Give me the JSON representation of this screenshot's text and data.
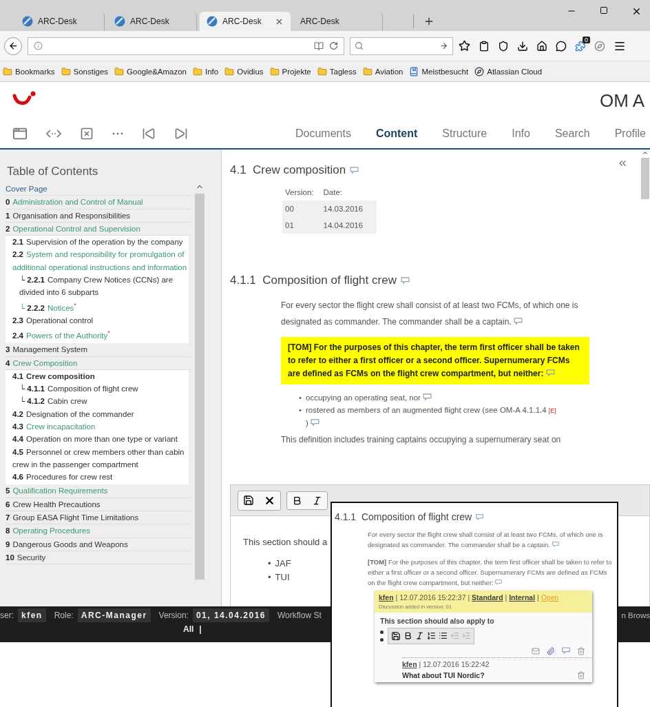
{
  "browser": {
    "tabs": [
      {
        "label": "ARC-Desk",
        "favicon": true,
        "selected": false
      },
      {
        "label": "ARC-Desk",
        "favicon": true,
        "selected": false
      },
      {
        "label": "ARC-Desk",
        "favicon": true,
        "selected": true
      },
      {
        "label": "ARC-Desk",
        "favicon": false,
        "selected": false
      }
    ],
    "extension_badge": "0",
    "bookmarks": [
      {
        "label": "Bookmarks",
        "kind": "folder"
      },
      {
        "label": "Sonstiges",
        "kind": "folder"
      },
      {
        "label": "Google&Amazon",
        "kind": "folder"
      },
      {
        "label": "Info",
        "kind": "folder"
      },
      {
        "label": "Ovidius",
        "kind": "folder"
      },
      {
        "label": "Projekte",
        "kind": "folder"
      },
      {
        "label": "Tagless",
        "kind": "folder"
      },
      {
        "label": "Aviation",
        "kind": "folder"
      },
      {
        "label": "Meistbesucht",
        "kind": "smart"
      },
      {
        "label": "Atlassian Cloud",
        "kind": "site"
      }
    ]
  },
  "app": {
    "title": "OM A",
    "nav": [
      {
        "label": "Documents",
        "selected": false
      },
      {
        "label": "Content",
        "selected": true
      },
      {
        "label": "Structure",
        "selected": false
      },
      {
        "label": "Info",
        "selected": false
      },
      {
        "label": "Search",
        "selected": false
      },
      {
        "label": "Profile",
        "selected": false
      }
    ]
  },
  "toc": {
    "title": "Table of Contents",
    "items": [
      {
        "label": "Cover Page",
        "color": "#2f5f8f",
        "selected": false
      },
      {
        "number": "0",
        "label": "Administration and Control of Manual",
        "color": "#3f9a6e",
        "selected": false
      },
      {
        "number": "1",
        "label": "Organisation and Responsibilities",
        "color": "#333333",
        "selected": false
      },
      {
        "number": "2",
        "label": "Operational Control and Supervision",
        "color": "#3f9a6e",
        "selected": false,
        "children": [
          {
            "number": "2.1",
            "label": "Supervision of the operation by the company",
            "color": "#333333",
            "selected": false
          },
          {
            "number": "2.2",
            "label": "System and responsibility for promulgation of additional operational instructions and information",
            "color": "#3f9a6e",
            "selected": false,
            "children": [
              {
                "branch": "└",
                "number": "2.2.1",
                "label": "Company Crew Notices (CCNs) are divided into 6 subparts",
                "color": "#333333",
                "selected": false
              },
              {
                "branch": "└",
                "number": "2.2.2",
                "label": "Notices",
                "marker": "*",
                "color": "#3f9a6e",
                "selected": false
              }
            ]
          },
          {
            "number": "2.3",
            "label": "Operational control",
            "color": "#333333",
            "selected": false
          },
          {
            "number": "2.4",
            "label": "Powers of the Authority",
            "marker": "*",
            "color": "#3f9a6e",
            "selected": false
          }
        ]
      },
      {
        "number": "3",
        "label": "Management System",
        "color": "#333333",
        "selected": false
      },
      {
        "number": "4",
        "label": "Crew Composition",
        "color": "#3f9a6e",
        "selected": false,
        "children": [
          {
            "number": "4.1",
            "label": "Crew composition",
            "color": "#333333",
            "selected": true,
            "children": [
              {
                "branch": "└",
                "number": "4.1.1",
                "label": "Composition of flight crew",
                "color": "#333333",
                "selected": false
              },
              {
                "branch": "└",
                "number": "4.1.2",
                "label": "Cabin crew",
                "color": "#333333",
                "selected": false
              }
            ]
          },
          {
            "number": "4.2",
            "label": "Designation of the commander",
            "color": "#333333",
            "selected": false
          },
          {
            "number": "4.3",
            "label": "Crew incapacitation",
            "color": "#3f9a6e",
            "selected": false
          },
          {
            "number": "4.4",
            "label": "Operation on more than one type or variant",
            "color": "#333333",
            "selected": false
          },
          {
            "number": "4.5",
            "label": "Personnel or crew members other than cabin crew in the passenger compartment",
            "color": "#333333",
            "selected": false
          },
          {
            "number": "4.6",
            "label": "Procedures for crew rest",
            "color": "#333333",
            "selected": false
          }
        ]
      },
      {
        "number": "5",
        "label": "Qualification Requirements",
        "color": "#3f9a6e",
        "selected": false
      },
      {
        "number": "6",
        "label": "Crew Health Precautions",
        "color": "#333333",
        "selected": false
      },
      {
        "number": "7",
        "label": "Group EASA Flight Time Limitations",
        "color": "#333333",
        "selected": false
      },
      {
        "number": "8",
        "label": "Operating Procedures",
        "color": "#3f9a6e",
        "selected": false
      },
      {
        "number": "9",
        "label": "Dangerous Goods and Weapons",
        "color": "#333333",
        "selected": false
      },
      {
        "number": "10",
        "label": "Security",
        "color": "#333333",
        "selected": false
      }
    ]
  },
  "content": {
    "section": {
      "number": "4.1",
      "title": "Crew composition"
    },
    "versions": {
      "columns": [
        "Version:",
        "Date:"
      ],
      "rows": [
        [
          "00",
          "14.03.2016"
        ],
        [
          "01",
          "14.04.2016"
        ]
      ]
    },
    "subsection": {
      "number": "4.1.1",
      "title": "Composition of flight crew"
    },
    "paragraph": "For every sector the flight crew shall consist of at least two FCMs, of which one is designated as commander. The commander shall be a captain.",
    "note": "[TOM] For the purposes of this chapter, the term first officer shall be taken to refer to either a first officer or a second officer. Supernumerary FCMs are defined as FCMs on the flight crew compartment, but neither:",
    "bullet": "•",
    "bullets": [
      {
        "text": "occupying an operating seat, nor"
      },
      {
        "text": "rostered as members of an augmented flight crew (see OM-A 4.1.1.4",
        "ref": "[E]",
        "tail": ")"
      }
    ],
    "next_line": "This definition includes training captains occupying a supernumerary seat on"
  },
  "editor": {
    "text": "This section should a",
    "bullet": "•",
    "bullets": [
      "JAF",
      "TUI"
    ]
  },
  "status_bar": {
    "fields": [
      {
        "label": "ser:",
        "value": "kfen"
      },
      {
        "label": "Role:",
        "value": "ARC-Manager"
      },
      {
        "label": "Version:",
        "value": "01, 14.04.2016"
      }
    ],
    "trailing": "Workflow St",
    "right": "n Brows",
    "filter": "All",
    "separator": "|"
  },
  "popup": {
    "heading": {
      "number": "4.1.1",
      "title": "Composition of flight crew"
    },
    "paragraph": "For every sector the flight crew shall consist of at least two FCMs, of which one is designated as commander. The commander shall be a captain.",
    "note": "**[TOM]** For the purposes of this chapter, the term first officer shall be taken to refer to either a first officer or a second officer. Supernumerary FCMs are defined as FCMs on the flight crew compartment, but neither:",
    "discussion": {
      "author": "kfen",
      "time": "12.07.2016 15:22:37",
      "separator": "|",
      "links": [
        {
          "label": "Standard",
          "kind": "plain"
        },
        {
          "label": "Internal",
          "kind": "plain"
        },
        {
          "label": "Open",
          "kind": "status"
        }
      ],
      "meta": "Discussion added in version: 01",
      "body": "This section should also apply to",
      "reply": {
        "author": "kfen",
        "time": "12.07.2016 15:22:42",
        "text": "What about TUI Nordic?"
      }
    }
  }
}
